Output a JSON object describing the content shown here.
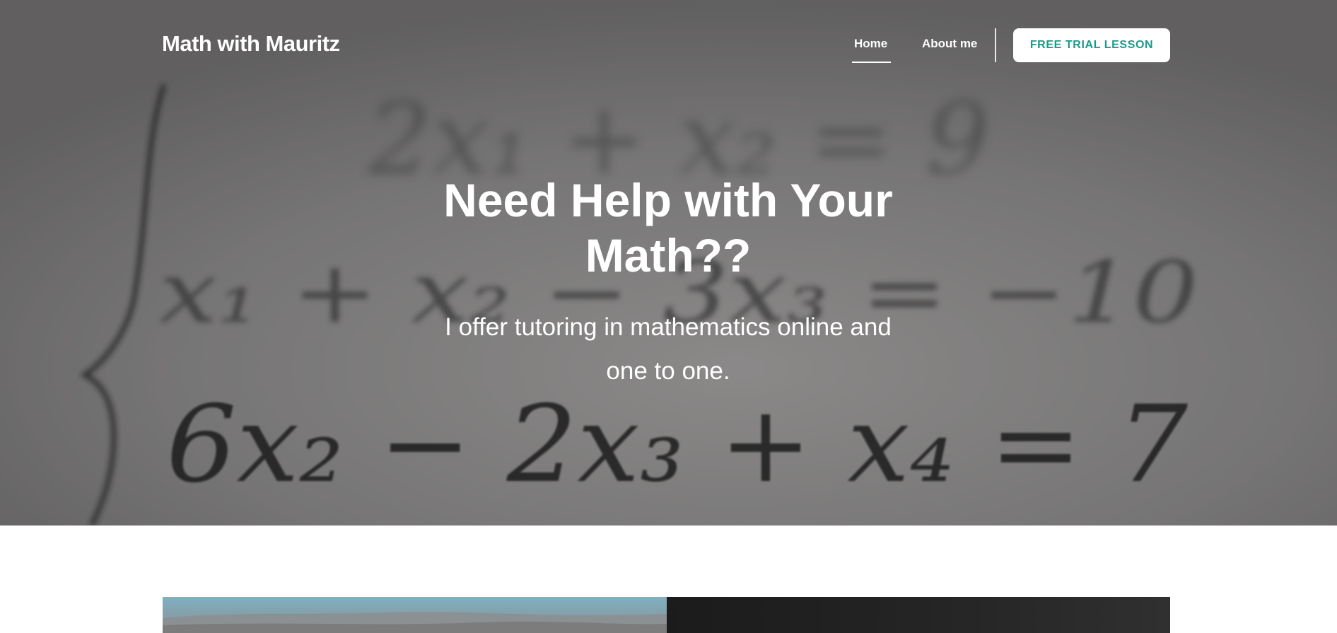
{
  "header": {
    "brand": "Math with Mauritz",
    "nav": [
      {
        "label": "Home",
        "active": true
      },
      {
        "label": "About me",
        "active": false
      }
    ],
    "cta_label": "FREE TRIAL LESSON"
  },
  "hero": {
    "title_line1": "Need Help with Your",
    "title_line2": "Math??",
    "subtitle_line1": "I offer tutoring in mathematics online and",
    "subtitle_line2": "one to one.",
    "background_equations": {
      "row1": "2x₁ + x₂ = 9",
      "row2": "x₁ + x₂ − 3x₃ = −10",
      "row3": "6x₂ − 2x₃ + x₄ = 7"
    }
  },
  "colors": {
    "accent": "#1a9a8a",
    "hero_bg": "#7a7878",
    "text_on_hero": "#ffffff"
  }
}
